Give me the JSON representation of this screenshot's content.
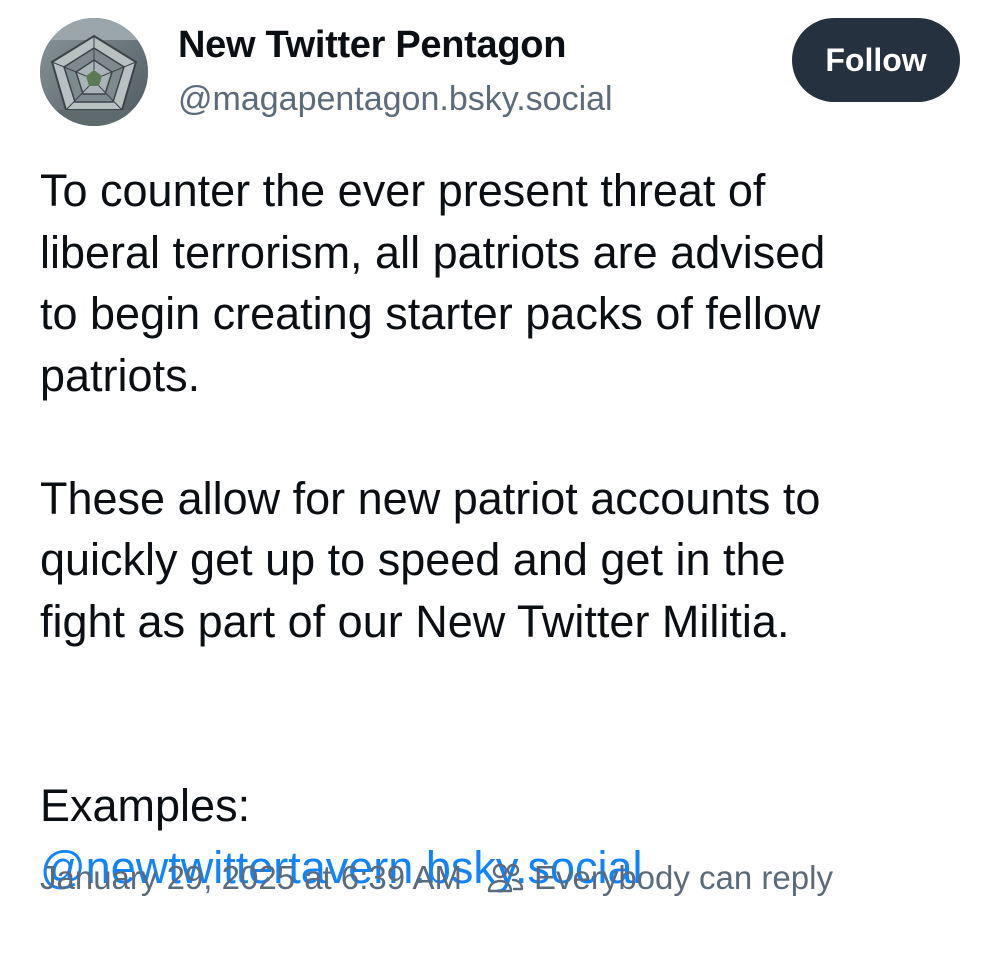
{
  "author": {
    "display_name": "New Twitter Pentagon",
    "handle": "@magapentagon.bsky.social",
    "avatar_icon": "pentagon-building-photo"
  },
  "actions": {
    "follow_label": "Follow"
  },
  "post": {
    "paragraph_1": "To counter the ever present threat of\nliberal terrorism, all patriots are advised\nto begin creating starter packs of fellow\npatriots.",
    "paragraph_2": "These allow for new patriot accounts to\nquickly get up to speed and get in the\nfight as part of our New Twitter Militia.",
    "examples_label": "Examples:",
    "mention": "@newtwittertavern.bsky.social"
  },
  "meta": {
    "timestamp": "January 29, 2025 at 6:39 AM",
    "reply_setting": "Everybody can reply",
    "reply_icon": "people-icon"
  },
  "colors": {
    "follow_button_bg": "#25313f",
    "link": "#1083fe",
    "muted_text": "#5b6b7c"
  }
}
